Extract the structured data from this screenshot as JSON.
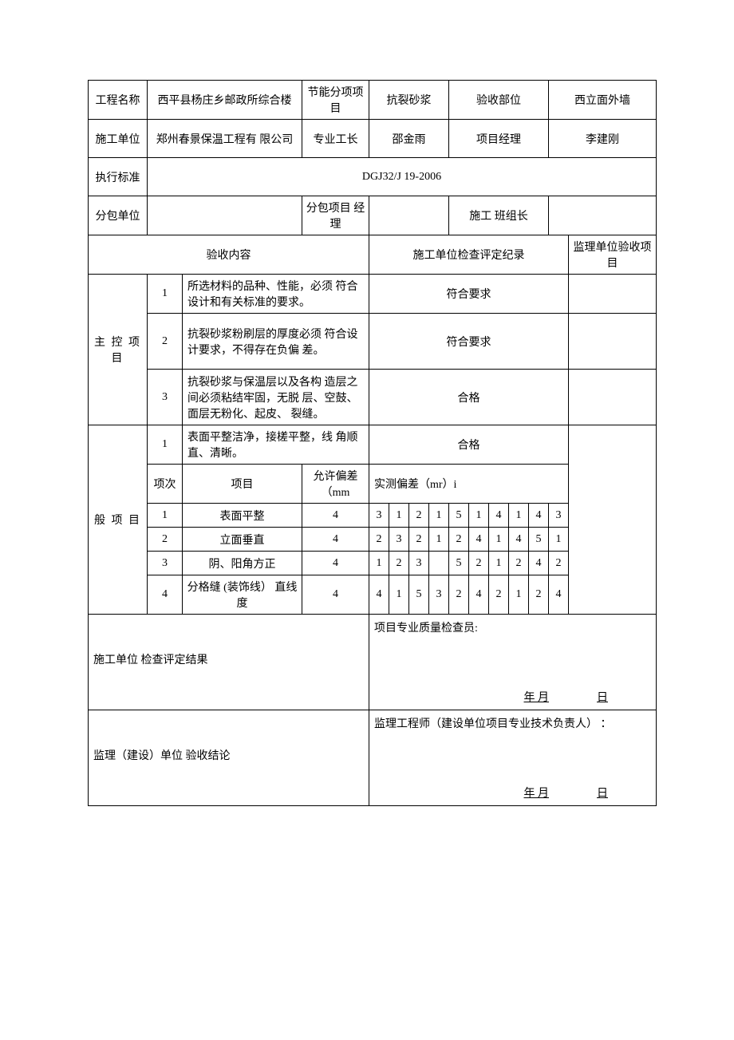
{
  "header": {
    "labels": {
      "project_name": "工程名称",
      "energy_item": "节能分项项目",
      "accept_part": "验收部位",
      "construct_unit": "施工单位",
      "foreman": "专业工长",
      "pm": "项目经理",
      "standard": "执行标准",
      "sub_unit": "分包单位",
      "sub_pm": "分包项目 经理",
      "team_leader": "施工 班组长"
    },
    "values": {
      "project_name": "西平县杨庄乡邮政所综合楼",
      "energy_item": "抗裂砂浆",
      "accept_part": "西立面外墙",
      "construct_unit": "郑州春景保温工程有 限公司",
      "foreman": "邵金雨",
      "pm": "李建刚",
      "standard": "DGJ32/J 19-2006",
      "sub_unit": "",
      "sub_pm": "",
      "team_leader": ""
    }
  },
  "section_titles": {
    "accept_content": "验收内容",
    "unit_check": "施工单位检查评定纪录",
    "supervise_accept": "监理单位验收项目",
    "main_items": "主 控 项 目",
    "general_items": "般 项 目",
    "row_num": "项次",
    "item": "项目",
    "tolerance": "允许偏差（mm",
    "measured": "实测偏差（mr）i"
  },
  "main_items": [
    {
      "num": "1",
      "desc": "所选材料的品种、性能，必须 符合设计和有关标准的要求。",
      "result": "符合要求"
    },
    {
      "num": "2",
      "desc": "抗裂砂浆粉刷层的厚度必须 符合设计要求，不得存在负偏 差。",
      "result": "符合要求"
    },
    {
      "num": "3",
      "desc": "抗裂砂浆与保温层以及各构 造层之间必须粘结牢固，无脱 层、空鼓、面层无粉化、起皮、 裂缝。",
      "result": "合格"
    }
  ],
  "general_first": {
    "num": "1",
    "desc": "表面平整洁净，接槎平整，线 角顺直、清晰。",
    "result": "合格"
  },
  "chart_data": {
    "type": "table",
    "columns": [
      "项次",
      "项目",
      "允许偏差（mm",
      "实测偏差"
    ],
    "rows": [
      {
        "num": "1",
        "item": "表面平整",
        "tol": "4",
        "vals": [
          "3",
          "1",
          "2",
          "1",
          "5",
          "1",
          "4",
          "1",
          "4",
          "3"
        ]
      },
      {
        "num": "2",
        "item": "立面垂直",
        "tol": "4",
        "vals": [
          "2",
          "3",
          "2",
          "1",
          "2",
          "4",
          "1",
          "4",
          "5",
          "1"
        ]
      },
      {
        "num": "3",
        "item": "阴、阳角方正",
        "tol": "4",
        "vals": [
          "1",
          "2",
          "3",
          "",
          "5",
          "2",
          "1",
          "2",
          "4",
          "2"
        ]
      },
      {
        "num": "4",
        "item": "分格缝 (装饰线） 直线度",
        "tol": "4",
        "vals": [
          "4",
          "1",
          "5",
          "3",
          "2",
          "4",
          "2",
          "1",
          "2",
          "4"
        ]
      }
    ]
  },
  "footer": {
    "unit_result_label": "施工单位 检查评定结果",
    "inspector_label": "项目专业质量检查员:",
    "supervise_label": "监理（建设）单位 验收结论",
    "engineer_label": "监理工程师（建设单位项目专业技术负责人）     ：",
    "date_ym": "年 月",
    "date_d": "日"
  }
}
